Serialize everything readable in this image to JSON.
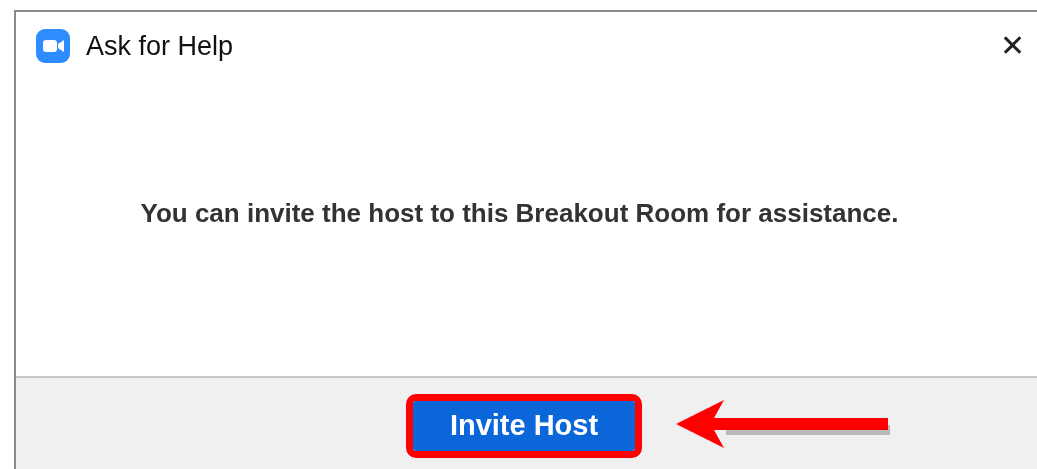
{
  "window": {
    "title": "Ask for Help",
    "close": "✕"
  },
  "message": "You can invite the host to this Breakout Room for assistance.",
  "buttons": [
    {
      "label": "Invite Host",
      "highlighted": true
    }
  ]
}
